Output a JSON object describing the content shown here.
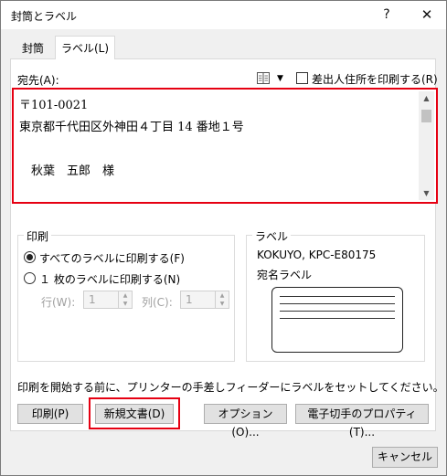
{
  "window": {
    "title": "封筒とラベル",
    "help": "?",
    "close": "✕"
  },
  "tabs": [
    {
      "label": "封筒"
    },
    {
      "label": "ラベル(L)"
    }
  ],
  "address": {
    "label": "宛先(A):",
    "text": "〒101-0021\n東京都千代田区外神田４丁目 14 番地１号\n\n　秋葉　五郎　様",
    "omit_return_label": "差出人住所を印刷する(R)",
    "omit_return_checked": false
  },
  "print_group": {
    "title": "印刷",
    "all_labels": "すべてのラベルに印刷する(F)",
    "single_label": "１ 枚のラベルに印刷する(N)",
    "selected": "all",
    "row_label": "行(W):",
    "row_value": "1",
    "col_label": "列(C):",
    "col_value": "1"
  },
  "label_group": {
    "title": "ラベル",
    "product": "KOKUYO, KPC-E80175",
    "type": "宛名ラベル"
  },
  "hint": "印刷を開始する前に、プリンターの手差しフィーダーにラベルをセットしてください。",
  "buttons": {
    "print": "印刷(P)",
    "new_document": "新規文書(D)",
    "options": "オプション(O)...",
    "epostage": "電子切手のプロパティ(T)...",
    "cancel": "キャンセル"
  },
  "colors": {
    "highlight": "#e60012"
  },
  "icons": {
    "address_book": "address-book-icon",
    "dropdown": "chevron-down-icon"
  }
}
